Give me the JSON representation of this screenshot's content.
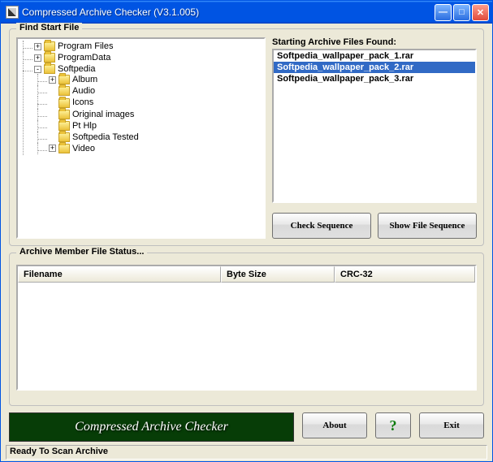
{
  "window": {
    "title": "Compressed Archive Checker (V3.1.005)"
  },
  "find": {
    "legend": "Find Start File",
    "tree": [
      {
        "label": "Program Files",
        "depth": 1,
        "exp": "+"
      },
      {
        "label": "ProgramData",
        "depth": 1,
        "exp": "+"
      },
      {
        "label": "Softpedia",
        "depth": 1,
        "exp": "-"
      },
      {
        "label": "Album",
        "depth": 2,
        "exp": "+"
      },
      {
        "label": "Audio",
        "depth": 2
      },
      {
        "label": "Icons",
        "depth": 2
      },
      {
        "label": "Original images",
        "depth": 2
      },
      {
        "label": "Pt Hlp",
        "depth": 2
      },
      {
        "label": "Softpedia Tested",
        "depth": 2
      },
      {
        "label": "Video",
        "depth": 2,
        "exp": "+"
      }
    ]
  },
  "found": {
    "label": "Starting Archive Files Found:",
    "items": [
      {
        "name": "Softpedia_wallpaper_pack_1.rar",
        "selected": false
      },
      {
        "name": "Softpedia_wallpaper_pack_2.rar",
        "selected": true
      },
      {
        "name": "Softpedia_wallpaper_pack_3.rar",
        "selected": false
      }
    ]
  },
  "buttons": {
    "check": "Check Sequence",
    "showseq": "Show File Sequence",
    "about": "About",
    "help": "?",
    "exit": "Exit"
  },
  "status_group": {
    "legend": "Archive Member File Status...",
    "columns": {
      "filename": "Filename",
      "bytesize": "Byte Size",
      "crc": "CRC-32"
    }
  },
  "banner": "Compressed Archive Checker",
  "statusbar": "Ready To Scan Archive"
}
